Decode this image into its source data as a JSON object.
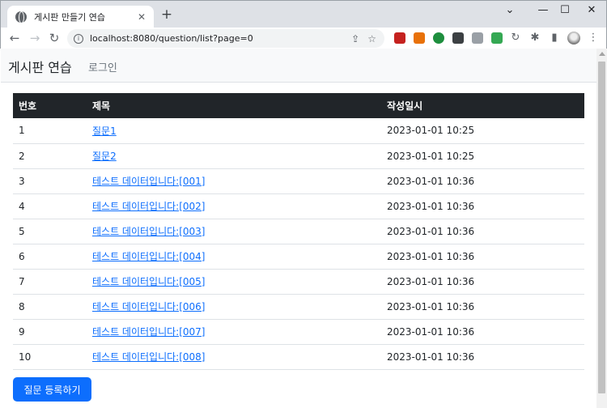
{
  "browser": {
    "tab_title": "게시판 만들기 연습",
    "tab_close": "✕",
    "new_tab": "+",
    "url": "localhost:8080/question/list?page=0",
    "window_minimize": "⌄",
    "window_restore": "—",
    "window_maximize": "☐",
    "window_close": "✕"
  },
  "nav": {
    "brand": "게시판 연습",
    "login": "로그인"
  },
  "table": {
    "headers": [
      "번호",
      "제목",
      "작성일시"
    ],
    "rows": [
      {
        "num": "1",
        "title": "질문1",
        "date": "2023-01-01 10:25"
      },
      {
        "num": "2",
        "title": "질문2",
        "date": "2023-01-01 10:25"
      },
      {
        "num": "3",
        "title": "테스트 데이터입니다:[001]",
        "date": "2023-01-01 10:36"
      },
      {
        "num": "4",
        "title": "테스트 데이터입니다:[002]",
        "date": "2023-01-01 10:36"
      },
      {
        "num": "5",
        "title": "테스트 데이터입니다:[003]",
        "date": "2023-01-01 10:36"
      },
      {
        "num": "6",
        "title": "테스트 데이터입니다:[004]",
        "date": "2023-01-01 10:36"
      },
      {
        "num": "7",
        "title": "테스트 데이터입니다:[005]",
        "date": "2023-01-01 10:36"
      },
      {
        "num": "8",
        "title": "테스트 데이터입니다:[006]",
        "date": "2023-01-01 10:36"
      },
      {
        "num": "9",
        "title": "테스트 데이터입니다:[007]",
        "date": "2023-01-01 10:36"
      },
      {
        "num": "10",
        "title": "테스트 데이터입니다:[008]",
        "date": "2023-01-01 10:36"
      }
    ]
  },
  "register_button": "질문 등록하기",
  "colors": {
    "primary": "#0d6efd",
    "table_header_bg": "#212529",
    "navbar_bg": "#f8f9fa"
  }
}
